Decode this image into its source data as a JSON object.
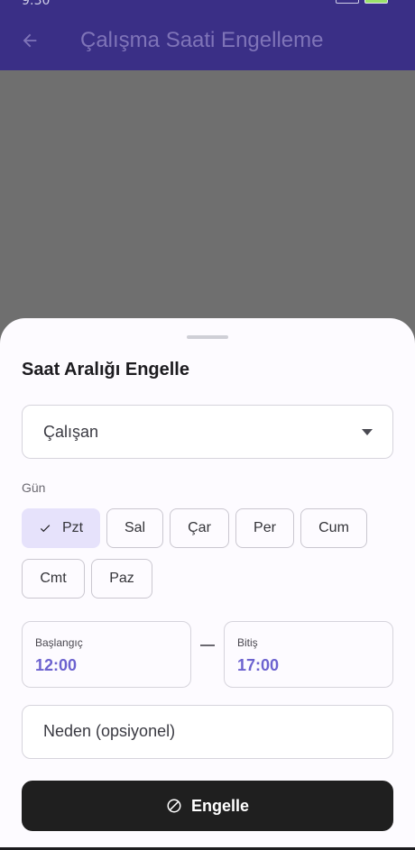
{
  "status": {
    "time": "9:30"
  },
  "app_bar": {
    "title": "Çalışma Saati Engelleme",
    "back_icon": "arrow-left-icon"
  },
  "sheet": {
    "title": "Saat Aralığı Engelle",
    "employee_select": {
      "label": "Çalışan",
      "icon": "dropdown-arrow-icon"
    },
    "day_label": "Gün",
    "days": [
      {
        "label": "Pzt",
        "selected": true
      },
      {
        "label": "Sal",
        "selected": false
      },
      {
        "label": "Çar",
        "selected": false
      },
      {
        "label": "Per",
        "selected": false
      },
      {
        "label": "Cum",
        "selected": false
      },
      {
        "label": "Cmt",
        "selected": false
      },
      {
        "label": "Paz",
        "selected": false
      }
    ],
    "start": {
      "label": "Başlangıç",
      "value": "12:00"
    },
    "end": {
      "label": "Bitiş",
      "value": "17:00"
    },
    "reason_placeholder": "Neden (opsiyonel)",
    "submit_label": "Engelle",
    "submit_icon": "block-icon"
  },
  "colors": {
    "app_bar": "#3a2f86",
    "accent": "#6c62cf",
    "selected_chip": "#e6e2fb",
    "button": "#1f1f1f"
  }
}
